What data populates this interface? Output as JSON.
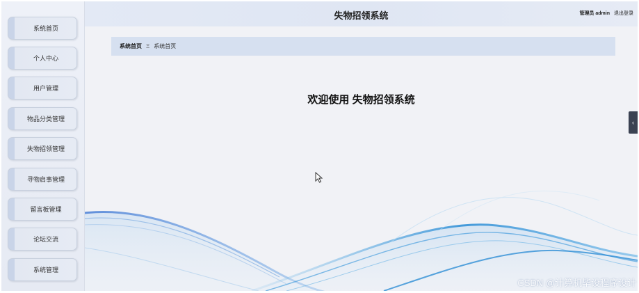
{
  "header": {
    "title": "失物招领系统",
    "admin_label": "管理员 admin",
    "logout_label": "退出登录"
  },
  "sidebar": {
    "items": [
      {
        "label": "系统首页"
      },
      {
        "label": "个人中心"
      },
      {
        "label": "用户管理"
      },
      {
        "label": "物品分类管理"
      },
      {
        "label": "失物招领管理"
      },
      {
        "label": "寻物启事管理"
      },
      {
        "label": "留言板管理"
      },
      {
        "label": "论坛交流"
      },
      {
        "label": "系统管理"
      }
    ]
  },
  "breadcrumb": {
    "home": "系统首页",
    "separator": "Ξ",
    "current": "系统首页"
  },
  "main": {
    "welcome": "欢迎使用 失物招领系统"
  },
  "collapse_icon": "chevron-left-icon",
  "watermark": "CSDN @计算机毕设程序设计",
  "colors": {
    "wave_blue": "#3a8fd8",
    "breadcrumb_bg": "#d6e0f0",
    "collapse_tab": "#3b4252"
  }
}
